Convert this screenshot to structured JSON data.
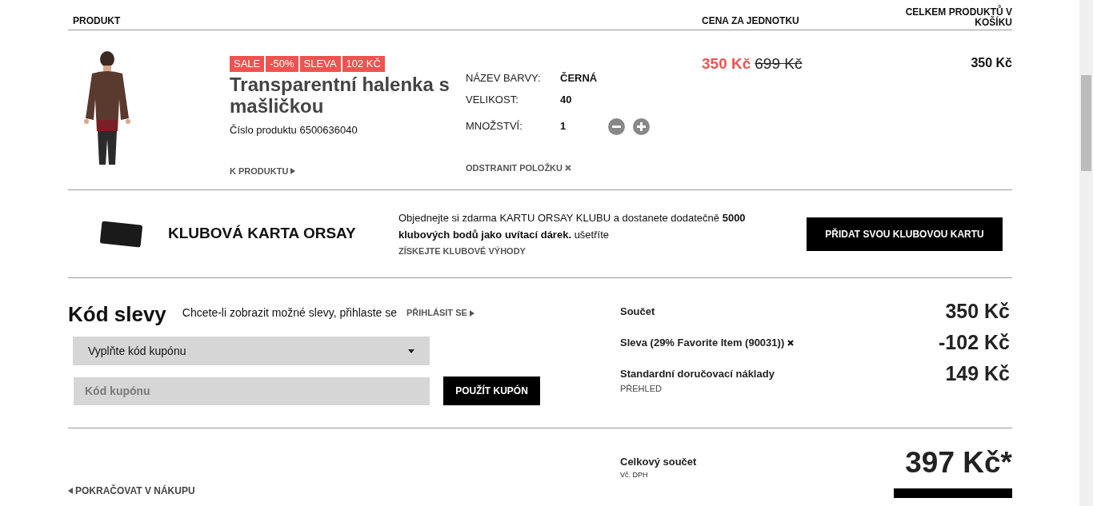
{
  "table_header": {
    "columns": [
      "PRODUKT",
      "CENA ZA JEDNOTKU",
      "CELKEM PRODUKTŮ V KOŠÍKU"
    ]
  },
  "cart_items": [
    {
      "image": {
        "kind": "picture"
      },
      "badges": [
        "SALE",
        "-50%",
        "SLEVA",
        "102 KČ"
      ],
      "name": "Transparentní halenka s mašličkou",
      "product_number": "Číslo produktu 6500636040",
      "product_link": "K PRODUKTU",
      "attributes": [
        {
          "label": "NÁZEV BARVY:",
          "value": "ČERNÁ"
        },
        {
          "label": "VELIKOST:",
          "value": "40"
        }
      ],
      "quantity": {
        "label": "MNOŽSTVÍ:",
        "value": "1"
      },
      "remove": "ODSTRANIT POLOŽKU",
      "unit_price": "350 Kč",
      "original_price": "699 Kč",
      "total": "350 Kč"
    }
  ],
  "club": {
    "title": "KLUBOVÁ KARTA ORSAY",
    "text": "Objednejte si zdarma KARTU ORSAY KLUBU a dostanete dodatečně **5000 klubových bodů jako uvítací dárek.** ušetříte",
    "link": "ZÍSKEJTE KLUBOVÉ VÝHODY",
    "button": "PŘIDAT SVOU KLUBOVOU KARTU"
  },
  "coupon": {
    "title": "Kód slevy",
    "hint": "Chcete-li zobrazit možné slevy, přihlaste se",
    "login_link": "PŘIHLÁSIT SE",
    "select": "Vyplňte kód kupónu",
    "input": {
      "placeholder": "Kód kupónu"
    },
    "button": "POUŽÍT KUPÓN"
  },
  "summary": {
    "rows": [
      {
        "kind": "plain",
        "label": "Součet",
        "value": "350 Kč"
      },
      {
        "kind": "removable",
        "label": "Sleva (29% Favorite Item (90031))",
        "value": "-102 Kč"
      },
      {
        "kind": "sub",
        "label": "Standardní doručovací náklady",
        "sublabel": "PŘEHLED",
        "value": "149 Kč"
      }
    ],
    "total": {
      "label": "Celkový součet",
      "note": "Vč. DPH",
      "value": "397 Kč*"
    }
  },
  "continue_link": "POKRAČOVAT V NÁKUPU"
}
